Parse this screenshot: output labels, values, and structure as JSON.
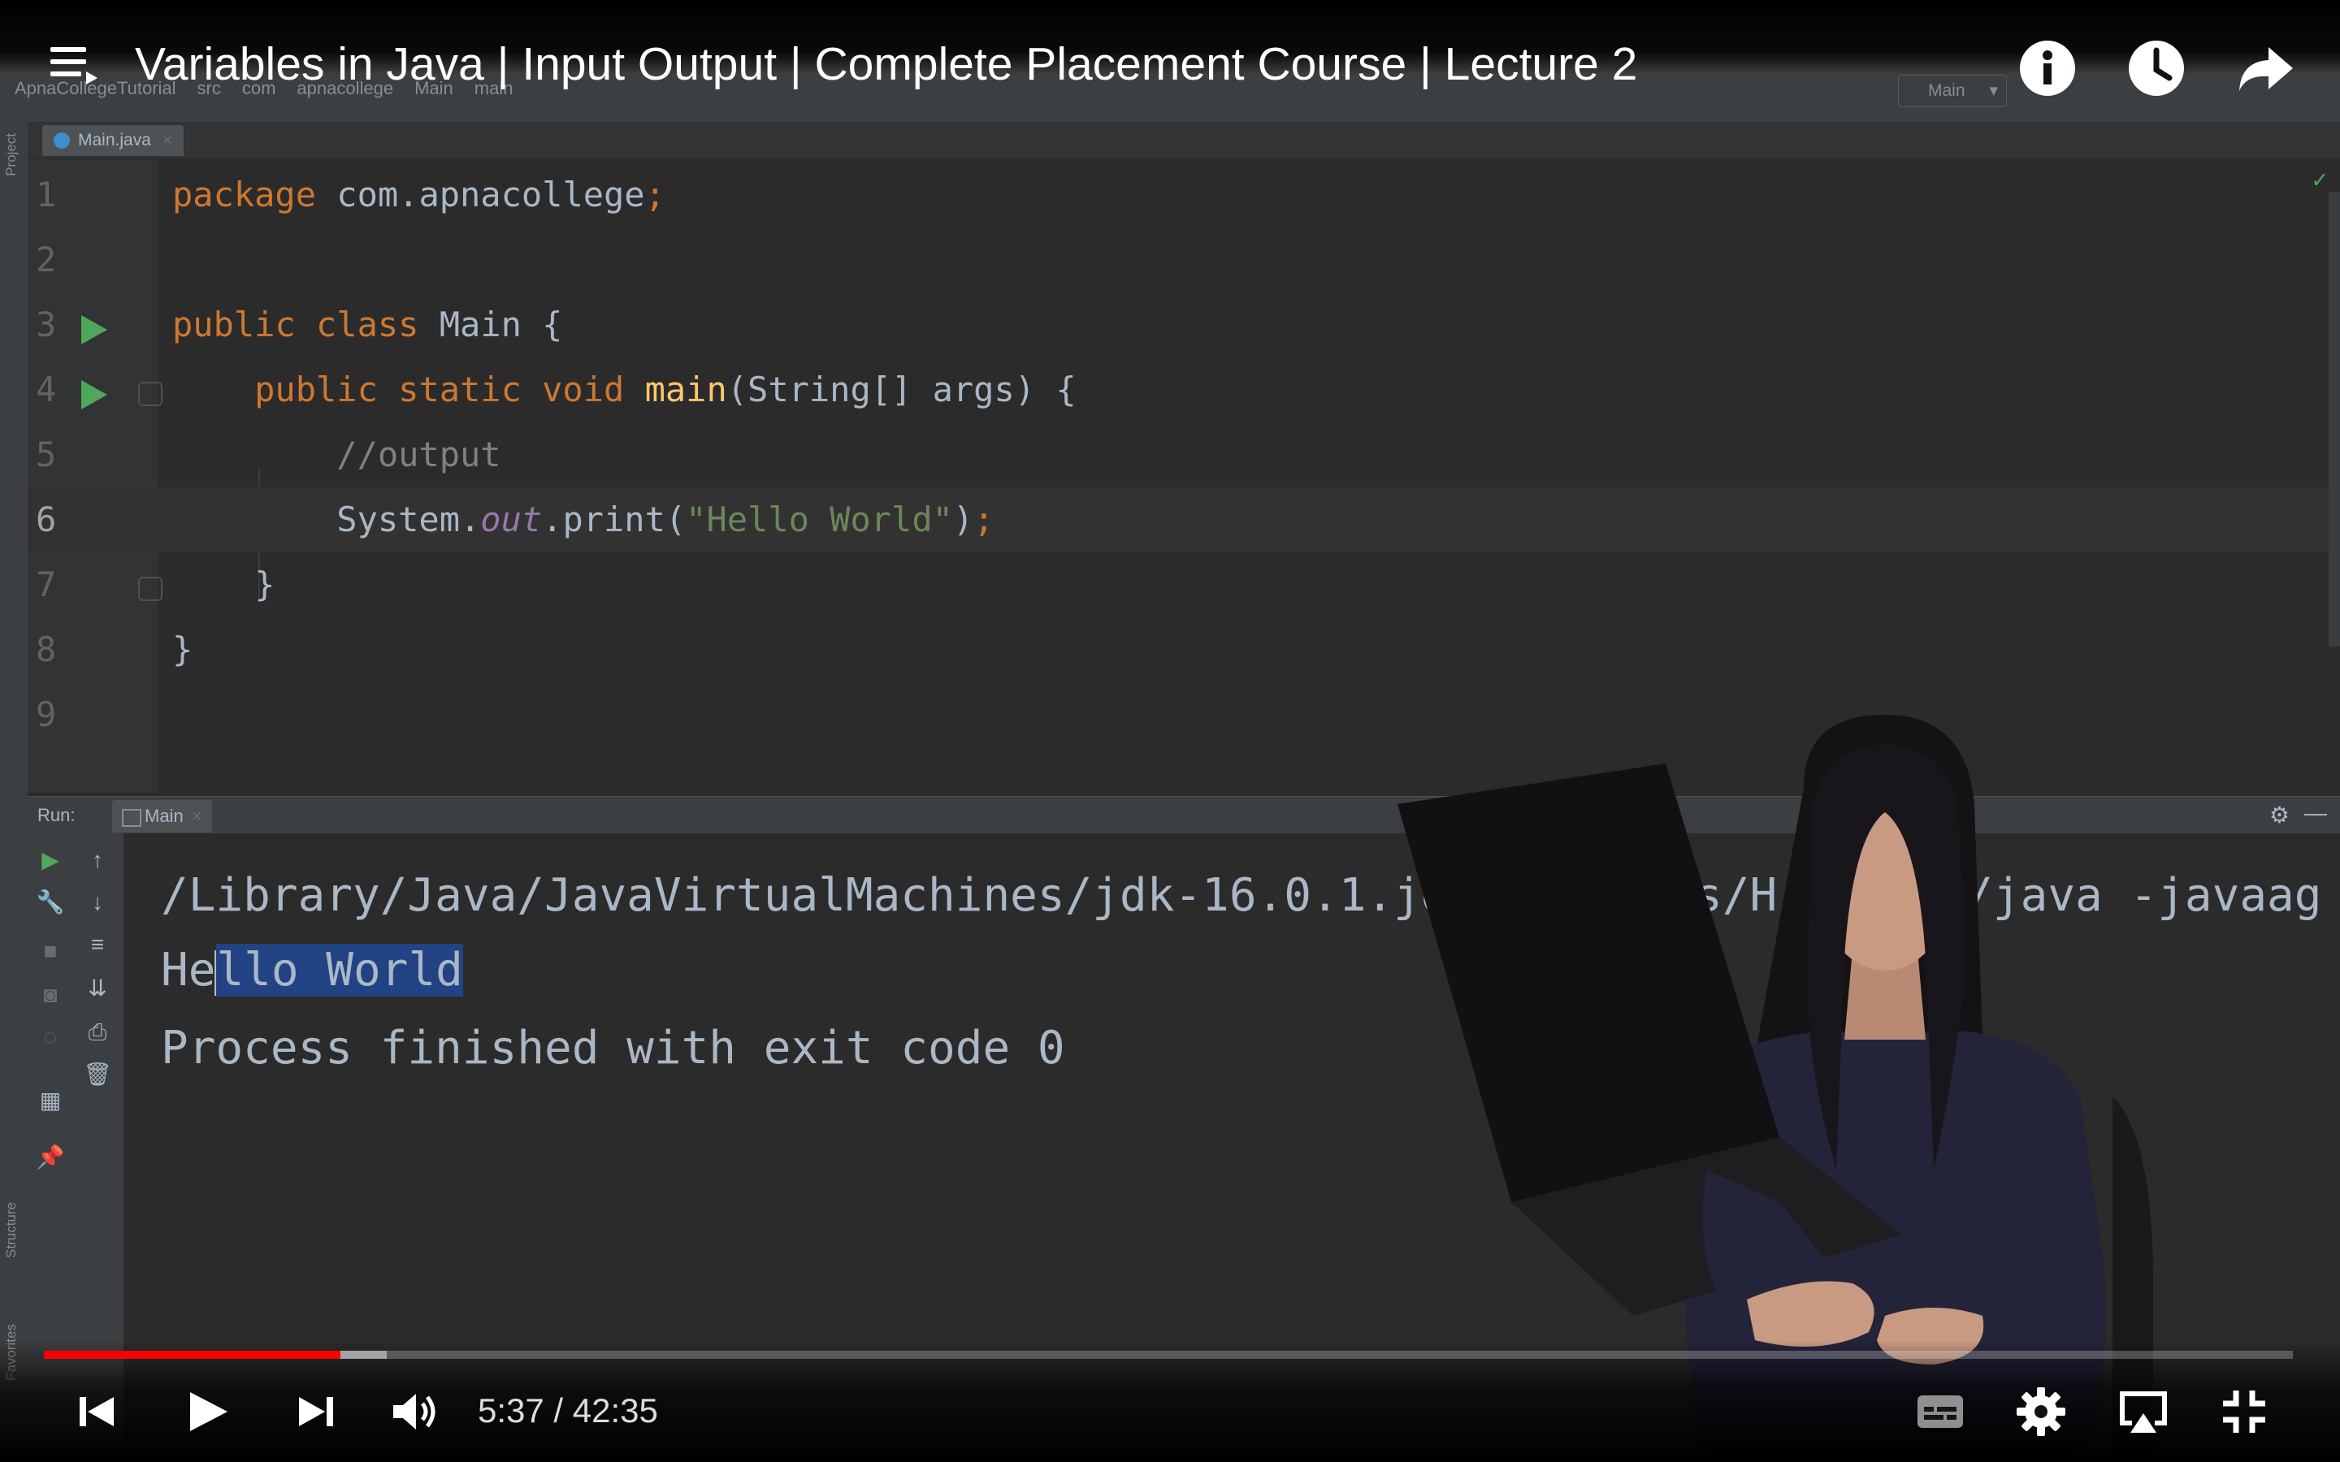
{
  "player": {
    "title": "Variables in Java | Input Output | Complete Placement Course | Lecture 2",
    "time_current": "5:37",
    "time_separator": " / ",
    "time_total": "42:35",
    "progress_played_fraction": 0.1318,
    "progress_loaded_fraction": 0.1523,
    "colors": {
      "progress": "#ff0000",
      "icons": "#ffffff"
    },
    "icons": [
      "menu-icon",
      "info-icon",
      "watch-later-icon",
      "share-icon",
      "previous-icon",
      "play-icon",
      "next-icon",
      "volume-icon",
      "subtitles-icon",
      "settings-icon",
      "airplay-icon",
      "exit-fullscreen-icon"
    ]
  },
  "ide": {
    "breadcrumb": [
      "ApnaCollegeTutorial",
      "src",
      "com",
      "apnacollege",
      "Main",
      "main"
    ],
    "run_config": "Main",
    "file_tab": "Main.java",
    "editor_lines": [
      {
        "num": "1",
        "tokens": [
          {
            "t": "package",
            "c": "kw"
          },
          {
            "t": " com.apnacollege",
            "c": ""
          },
          {
            "t": ";",
            "c": "kw"
          }
        ]
      },
      {
        "num": "2",
        "tokens": []
      },
      {
        "num": "3",
        "tokens": [
          {
            "t": "public class ",
            "c": "kw"
          },
          {
            "t": "Main {",
            "c": ""
          }
        ],
        "run": true
      },
      {
        "num": "4",
        "tokens": [
          {
            "t": "    public static void ",
            "c": "kw"
          },
          {
            "t": "main",
            "c": "fn"
          },
          {
            "t": "(String[] args) {",
            "c": ""
          }
        ],
        "run": true,
        "fold": true
      },
      {
        "num": "5",
        "tokens": [
          {
            "t": "        //output",
            "c": "cm"
          }
        ]
      },
      {
        "num": "6",
        "tokens": [
          {
            "t": "        System.",
            "c": ""
          },
          {
            "t": "out",
            "c": "fld"
          },
          {
            "t": ".print(",
            "c": ""
          },
          {
            "t": "\"Hello World\"",
            "c": "st"
          },
          {
            "t": ")",
            "c": ""
          },
          {
            "t": ";",
            "c": "kw"
          }
        ],
        "active": true
      },
      {
        "num": "7",
        "tokens": [
          {
            "t": "    }",
            "c": ""
          }
        ],
        "fold": true
      },
      {
        "num": "8",
        "tokens": [
          {
            "t": "}",
            "c": ""
          }
        ]
      },
      {
        "num": "9",
        "tokens": []
      }
    ],
    "run_panel": {
      "label": "Run:",
      "tab": "Main",
      "console_path": "/Library/Java/JavaVirtualMachines/jdk-16.0.1.jdk/Contents/H",
      "console_path_tail": "/java -javaag",
      "output_pre": "He",
      "output_sel_a": "l",
      "output_sel_b": "lo World",
      "exit_line": "Process finished with exit code 0"
    },
    "side_labels": [
      "Project",
      "Structure",
      "Favorites"
    ]
  }
}
